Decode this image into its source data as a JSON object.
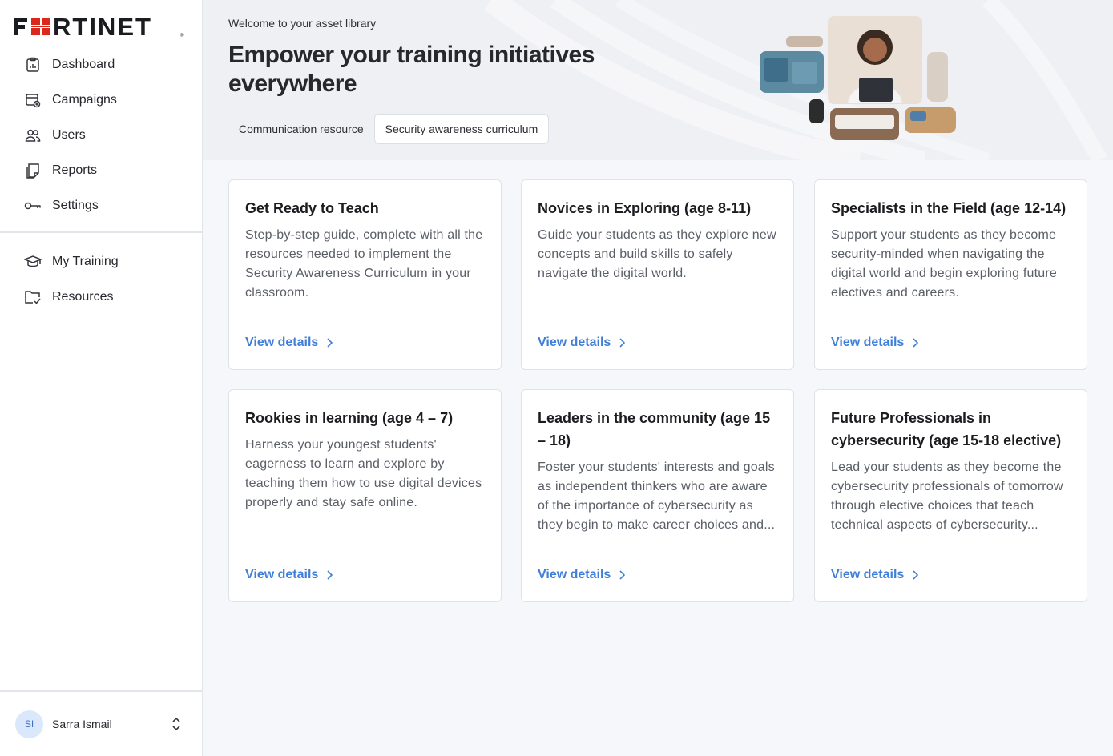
{
  "brand": {
    "logo_text": "FORTINET",
    "accent": "#3f7fd8",
    "logo_red": "#da291c"
  },
  "sidebar": {
    "primary": [
      {
        "label": "Dashboard",
        "icon": "clipboard-chart-icon"
      },
      {
        "label": "Campaigns",
        "icon": "calendar-add-icon"
      },
      {
        "label": "Users",
        "icon": "users-icon"
      },
      {
        "label": "Reports",
        "icon": "documents-icon"
      },
      {
        "label": "Settings",
        "icon": "key-icon"
      }
    ],
    "secondary": [
      {
        "label": "My Training",
        "icon": "graduation-cap-icon"
      },
      {
        "label": "Resources",
        "icon": "folder-check-icon"
      }
    ],
    "user": {
      "initials": "SI",
      "name": "Sarra Ismail"
    }
  },
  "hero": {
    "welcome": "Welcome to your asset library",
    "title": "Empower your training initiatives everywhere",
    "tabs": [
      {
        "label": "Communication resource",
        "active": false
      },
      {
        "label": "Security awareness curriculum",
        "active": true
      }
    ]
  },
  "cards": [
    {
      "title": "Get Ready to Teach",
      "description": "Step-by-step guide, complete with all the resources needed to implement the Security Awareness Curriculum in your classroom.",
      "link": "View details"
    },
    {
      "title": "Novices in Exploring (age 8-11)",
      "description": "Guide your students as they explore new concepts and build skills to safely navigate the digital world.",
      "link": "View details"
    },
    {
      "title": "Specialists in the Field (age 12-14)",
      "description": "Support your students as they become security-minded when navigating the digital world and begin exploring future electives and careers.",
      "link": "View details"
    },
    {
      "title": "Rookies in learning (age 4 – 7)",
      "description": "Harness your youngest students' eagerness to learn and explore by teaching them how to use digital devices properly and stay safe online.",
      "link": "View details"
    },
    {
      "title": "Leaders in the community (age 15 – 18)",
      "description": "Foster your students' interests and goals as independent thinkers who are aware of the importance of cybersecurity as they begin to make career choices and...",
      "link": "View details"
    },
    {
      "title": "Future Professionals in cybersecurity (age 15-18 elective)",
      "description": "Lead your students as they become the cybersecurity professionals of tomorrow through elective choices that teach technical aspects of cybersecurity...",
      "link": "View details"
    }
  ]
}
